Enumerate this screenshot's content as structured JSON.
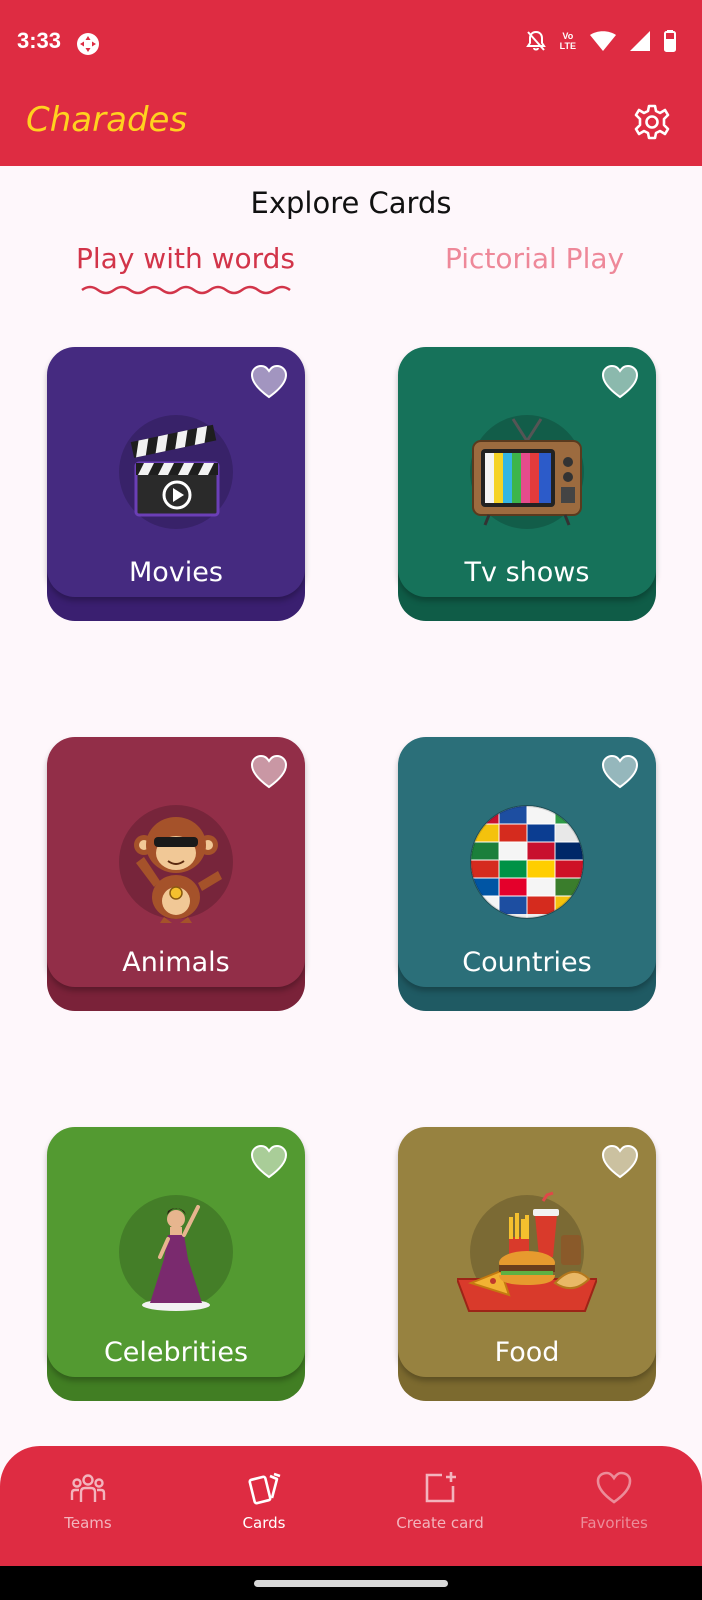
{
  "status": {
    "time": "3:33",
    "network_label_top": "Vo",
    "network_label_bottom": "LTE"
  },
  "app": {
    "title": "Charades",
    "settings_icon": "gear-icon"
  },
  "page": {
    "heading": "Explore Cards"
  },
  "modes": {
    "active": "Play with words",
    "inactive": "Pictorial Play"
  },
  "cards": [
    {
      "label": "Movies",
      "icon": "clapperboard-icon",
      "color": "#452A80",
      "base": "#3A1F70"
    },
    {
      "label": "Tv shows",
      "icon": "tv-icon",
      "color": "#16725A",
      "base": "#0F5C47"
    },
    {
      "label": "Animals",
      "icon": "monkey-icon",
      "color": "#922E48",
      "base": "#7A2239"
    },
    {
      "label": "Countries",
      "icon": "globe-icon",
      "color": "#2B6F79",
      "base": "#1F5A63"
    },
    {
      "label": "Celebrities",
      "icon": "celebrity-icon",
      "color": "#539A31",
      "base": "#417E23"
    },
    {
      "label": "Food",
      "icon": "food-tray-icon",
      "color": "#978240",
      "base": "#7C6A2F"
    }
  ],
  "nav": {
    "teams": "Teams",
    "cards": "Cards",
    "create": "Create card",
    "favorites": "Favorites"
  },
  "colors": {
    "primary": "#DE2C42",
    "title": "#FFD21F",
    "nav_active": "#FFFFFF",
    "nav_inactive": "#F3B4BD",
    "nav_disabled": "#EC8C99"
  }
}
